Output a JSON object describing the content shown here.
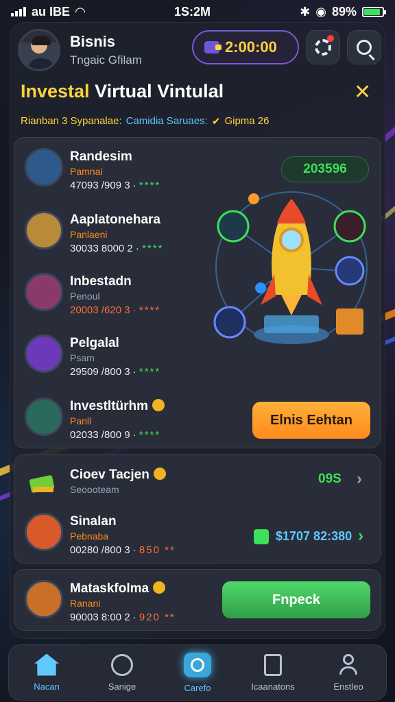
{
  "status_bar": {
    "carrier": "au IBE",
    "time": "1S:2M",
    "battery": "89%"
  },
  "header": {
    "user_name": "Bisnis",
    "user_sub": "Tngaic Gfilam",
    "balance": "2:00:00"
  },
  "page": {
    "title_highlight": "Investal",
    "title_rest": " Virtual Vintulal",
    "sub_left": "Rianban 3 Sypanalae:",
    "sub_mid": "Camidia Saruaes:",
    "sub_right": "Gipma 26"
  },
  "featured": {
    "value_pill": "203596",
    "rows": [
      {
        "title": "Randesim",
        "subtitle": "Pamnai",
        "value": "47093 /909 3 ·",
        "stars": "****"
      },
      {
        "title": "Aaplatonehara",
        "subtitle": "Panlaeni",
        "value": "30033 8000 2 ·",
        "stars": "****"
      },
      {
        "title": "Inbestadn",
        "subtitle": "Penoul",
        "value": "20003 /620 3 ·",
        "stars": "****"
      },
      {
        "title": "Pelgalal",
        "subtitle": "Psam",
        "value": "29509 /800 3 ·",
        "stars": "****"
      },
      {
        "title": "Investltürhm",
        "subtitle": "Panll",
        "value": "02033 /800 9 ·",
        "stars": "****"
      }
    ],
    "cta_label": "Elnis Eehtan"
  },
  "list": {
    "rows": [
      {
        "title": "Cioev Tacjen",
        "subtitle": "Seoooteam",
        "value": "09S"
      },
      {
        "title": "Sinalan",
        "subtitle": "Pebnaba",
        "value": "$1707 82:380",
        "extra": "00280 /800 3 ·",
        "stars": "850 **"
      }
    ]
  },
  "bottom_card": {
    "title": "Mataskfolma",
    "subtitle": "Ranani",
    "value": "90003 8:00 2 ·",
    "stars": "920 **",
    "cta_label": "Fnpeck"
  },
  "nav": [
    {
      "label": "Nacan"
    },
    {
      "label": "Sanige"
    },
    {
      "label": "Carefo"
    },
    {
      "label": "Icaanatons"
    },
    {
      "label": "Enstleo"
    }
  ],
  "colors": {
    "accent": "#ffd23f",
    "green": "#3ce05a",
    "orange": "#ff8a1e",
    "blue": "#5fc8ff"
  }
}
